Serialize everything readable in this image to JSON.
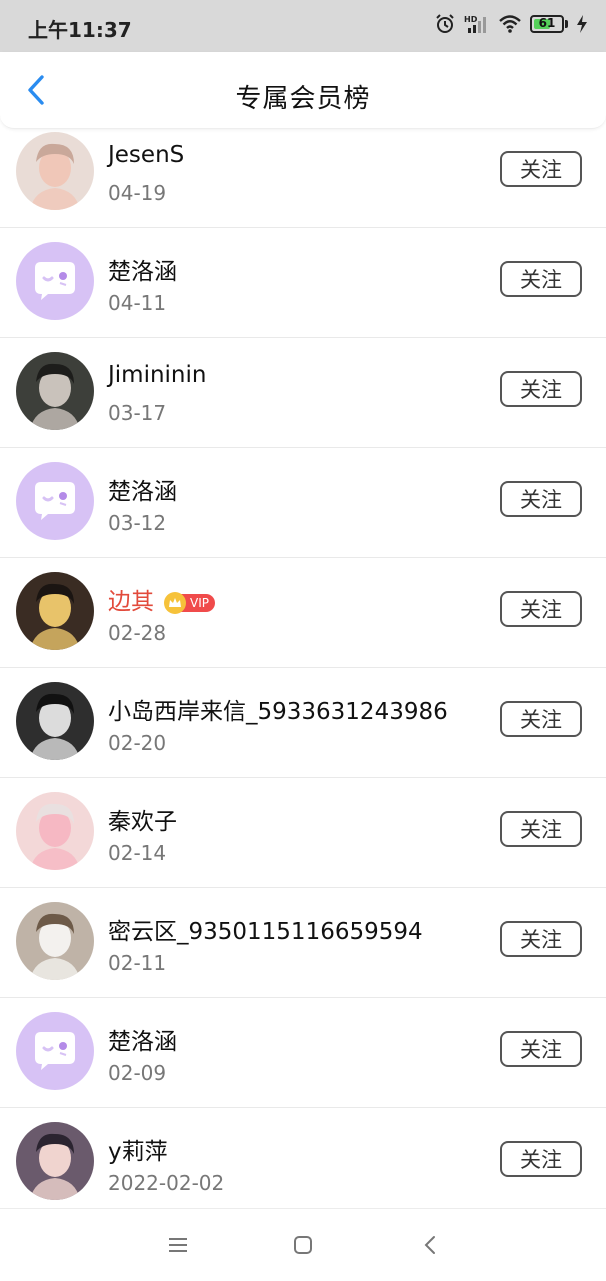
{
  "status_bar": {
    "time": "上午11:37",
    "battery_level": "61",
    "battery_fraction": 0.61,
    "icons": [
      "alarm-icon",
      "hd-signal-icon",
      "wifi-icon",
      "battery-icon",
      "charging-icon"
    ]
  },
  "header": {
    "title": "专属会员榜",
    "back_icon": "chevron-left-icon",
    "accent": "#2a8cf0"
  },
  "members": [
    {
      "name": "JesenS",
      "date": "04-19",
      "follow": "关注",
      "vip": false
    },
    {
      "name": "楚洛涵",
      "date": "04-11",
      "follow": "关注",
      "vip": false
    },
    {
      "name": "Jimininin",
      "date": "03-17",
      "follow": "关注",
      "vip": false
    },
    {
      "name": "楚洛涵",
      "date": "03-12",
      "follow": "关注",
      "vip": false
    },
    {
      "name": "边其",
      "date": "02-28",
      "follow": "关注",
      "vip": true,
      "vip_label": "VIP"
    },
    {
      "name": "小岛西岸来信_5933631243986",
      "date": "02-20",
      "follow": "关注",
      "vip": false
    },
    {
      "name": "秦欢子",
      "date": "02-14",
      "follow": "关注",
      "vip": false
    },
    {
      "name": "密云区_9350115116659594",
      "date": "02-11",
      "follow": "关注",
      "vip": false
    },
    {
      "name": "楚洛涵",
      "date": "02-09",
      "follow": "关注",
      "vip": false
    },
    {
      "name": "y莉萍",
      "date": "2022-02-02",
      "follow": "关注",
      "vip": false
    }
  ],
  "colors": {
    "vip_name": "#e24a3b",
    "default_avatar": "#d7c2f5",
    "status_bar_bg": "#d9d9d9"
  },
  "nav": {
    "icons": [
      "menu-icon",
      "home-square-icon",
      "back-triangle-icon"
    ]
  }
}
